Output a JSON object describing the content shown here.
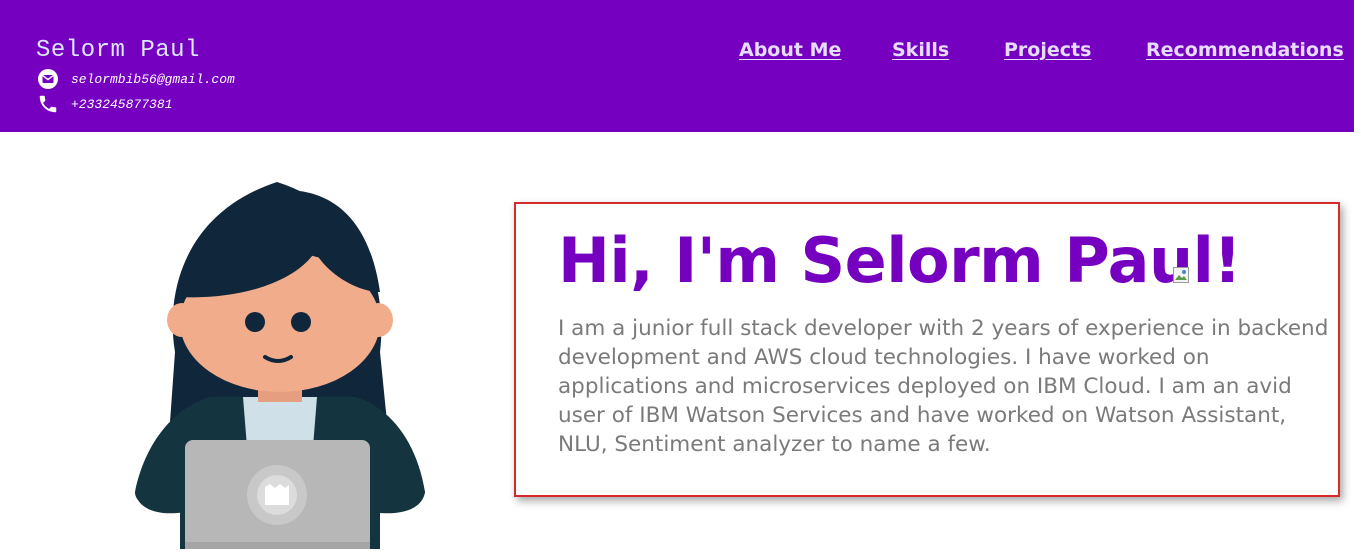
{
  "header": {
    "name": "Selorm Paul",
    "email": "selormbib56@gmail.com",
    "phone": "+233245877381",
    "nav": [
      {
        "label": "About Me"
      },
      {
        "label": "Skills"
      },
      {
        "label": "Projects"
      },
      {
        "label": "Recommendations"
      }
    ],
    "icons": {
      "email": "email-icon",
      "phone": "phone-icon"
    }
  },
  "hero": {
    "avatar_icon": "developer-avatar-illustration",
    "heading": "Hi, I'm Selorm Paul!",
    "broken_image_icon": "broken-image-icon",
    "bio": "I am a junior full stack developer with 2 years of experience in backend development and AWS cloud technologies. I have worked on applications and microservices deployed on IBM Cloud. I am an avid user of IBM Watson Services and have worked on Watson Assistant, NLU, Sentiment analyzer to name a few."
  },
  "colors": {
    "header_bg": "#7600c0",
    "heading": "#7600c0",
    "body_text": "#7a7a7a",
    "card_border": "#d42a2a"
  }
}
